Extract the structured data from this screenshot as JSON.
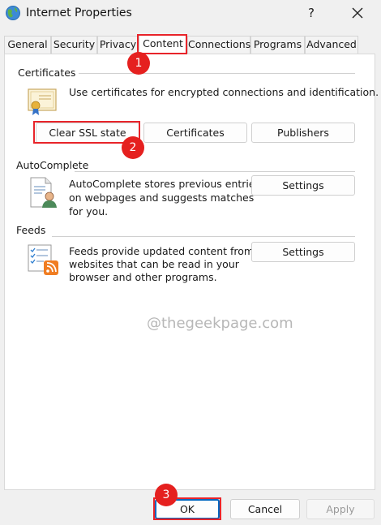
{
  "window": {
    "title": "Internet Properties",
    "help_label": "?"
  },
  "tabs": [
    "General",
    "Security",
    "Privacy",
    "Content",
    "Connections",
    "Programs",
    "Advanced"
  ],
  "certificates": {
    "heading": "Certificates",
    "description": "Use certificates for encrypted connections and identification.",
    "buttons": {
      "clear_ssl": "Clear SSL state",
      "certificates": "Certificates",
      "publishers": "Publishers"
    }
  },
  "autocomplete": {
    "heading": "AutoComplete",
    "description_lines": [
      "AutoComplete stores previous entries",
      "on webpages and suggests matches",
      "for you."
    ],
    "settings_label": "Settings"
  },
  "feeds": {
    "heading": "Feeds",
    "description_lines": [
      "Feeds provide updated content from",
      "websites that can be read in your",
      "browser and other programs."
    ],
    "settings_label": "Settings"
  },
  "watermark": "@thegeekpage.com",
  "footer": {
    "ok": "OK",
    "cancel": "Cancel",
    "apply": "Apply"
  },
  "annotations": {
    "step1": "1",
    "step2": "2",
    "step3": "3"
  },
  "colors": {
    "annotation_red": "#e5201f",
    "panel": "#ffffff",
    "window": "#f0f0f0"
  }
}
